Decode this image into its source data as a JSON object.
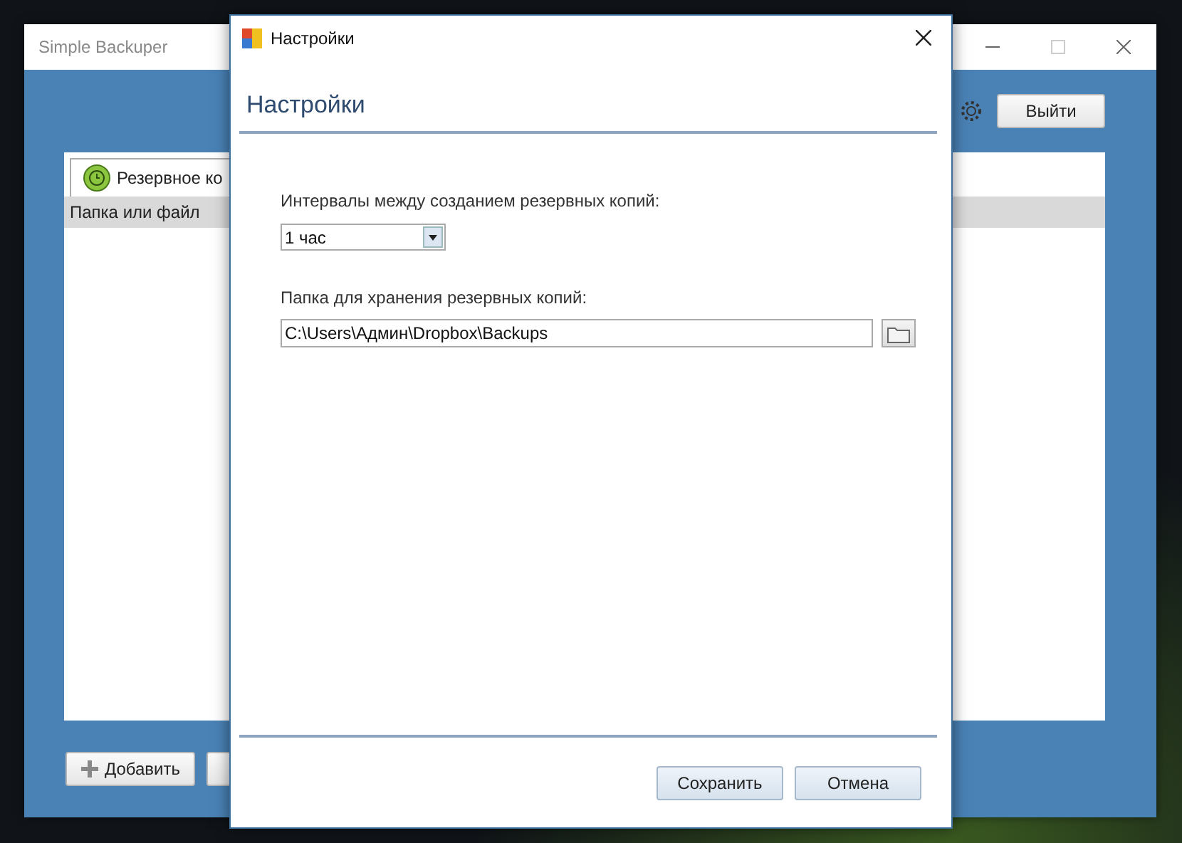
{
  "main_window": {
    "title": "Simple Backuper",
    "exit_button": "Выйти",
    "tab": {
      "label": "Резервное ко",
      "selected": true
    },
    "table": {
      "columns": [
        "Папка или файл"
      ]
    },
    "add_button": "Добавить"
  },
  "dialog": {
    "title": "Настройки",
    "heading": "Настройки",
    "interval": {
      "label": "Интервалы между созданием резервных копий:",
      "value": "1 час"
    },
    "folder": {
      "label": "Папка для хранения резервных копий:",
      "value": "C:\\Users\\Админ\\Dropbox\\Backups"
    },
    "buttons": [
      "Сохранить",
      "Отмена"
    ]
  }
}
